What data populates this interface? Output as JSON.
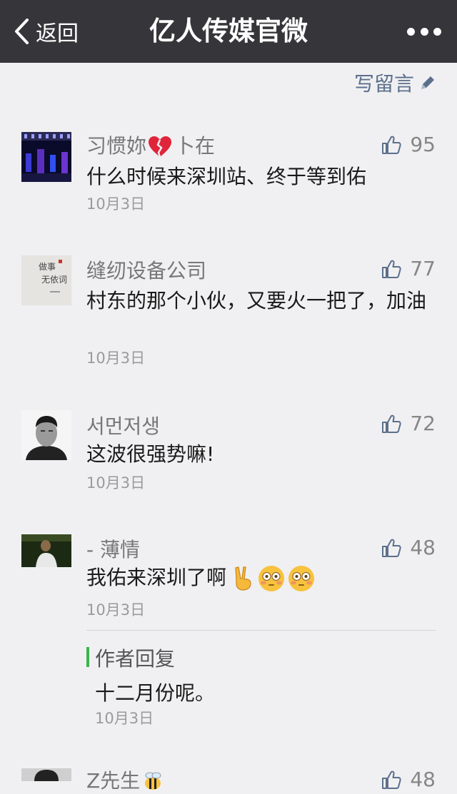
{
  "nav": {
    "back_label": "返回",
    "title": "亿人传媒官微"
  },
  "write_label": "写留言",
  "comments": [
    {
      "name_part1": "习惯妳",
      "name_icon": "broken-heart-emoji",
      "name_part2": "卜在",
      "text": "什么时候来深圳站、终于等到佑",
      "date": "10月3日",
      "likes": "95"
    },
    {
      "name": "缝纫设备公司",
      "text": "村东的那个小伙，又要火一把了，加油",
      "date": "10月3日",
      "likes": "77",
      "avatar_text": "做事无依词"
    },
    {
      "name": "서먼저생",
      "text": "这波很强势嘛!",
      "date": "10月3日",
      "likes": "72"
    },
    {
      "name": "- 薄情",
      "text": "我佑来深圳了啊",
      "text_icons": [
        "victory-hand-emoji",
        "flushed-face-emoji",
        "flushed-face-emoji"
      ],
      "date": "10月3日",
      "likes": "48",
      "reply": {
        "label": "作者回复",
        "text": "十二月份呢。",
        "date": "10月3日"
      }
    },
    {
      "name": "Z先生",
      "name_icon": "bee-emoji",
      "likes": "48"
    }
  ],
  "colors": {
    "navbar": "#363539",
    "background": "#f0f0f2",
    "link": "#5c6f8c",
    "reply_bar": "#39b54a"
  }
}
